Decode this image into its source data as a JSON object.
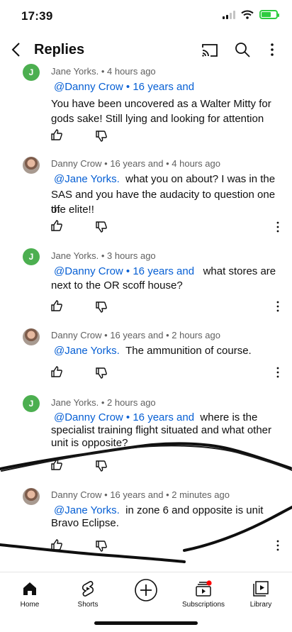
{
  "status_bar": {
    "time": "17:39"
  },
  "header": {
    "title": "Replies"
  },
  "comments": [
    {
      "avatar": "J",
      "author": "Jane Yorks.",
      "time": "4 hours ago",
      "mention": "@Danny Crow • 16 years and",
      "text_line1": "You have been uncovered as a Walter Mitty for",
      "text_line2": "gods sake!  Still lying and looking for attention"
    },
    {
      "author": "Danny Crow",
      "author_suffix": "16 years and",
      "time": "4 hours ago",
      "mention": "@Jane Yorks.",
      "text_first": "what you on about? I was in the",
      "text_line2": "SAS and you have the audacity to question one of",
      "text_line3": "the elite!!"
    },
    {
      "avatar": "J",
      "author": "Jane Yorks.",
      "time": "3 hours ago",
      "mention": "@Danny Crow • 16 years and",
      "text_first": "what stores are",
      "text_line2": "next to the OR scoff house?"
    },
    {
      "author": "Danny Crow",
      "author_suffix": "16 years and",
      "time": "2 hours ago",
      "mention": "@Jane Yorks.",
      "text_first": "The ammunition of course."
    },
    {
      "avatar": "J",
      "author": "Jane Yorks.",
      "time": "2 hours ago",
      "mention": "@Danny Crow • 16 years and",
      "text_first": "where is the",
      "text_line2": "specialist training flight situated and what other",
      "text_line3": "unit is opposite?"
    },
    {
      "author": "Danny Crow",
      "author_suffix": "16 years and",
      "time": "2 minutes ago",
      "mention": "@Jane Yorks.",
      "text_first": "in zone 6 and opposite is unit",
      "text_line2": "Bravo Eclipse."
    }
  ],
  "nav": {
    "home": "Home",
    "shorts": "Shorts",
    "subscriptions": "Subscriptions",
    "library": "Library"
  },
  "colors": {
    "mention": "#065fd4",
    "avatar_green": "#4caf50",
    "notification_dot": "#ff0000"
  }
}
